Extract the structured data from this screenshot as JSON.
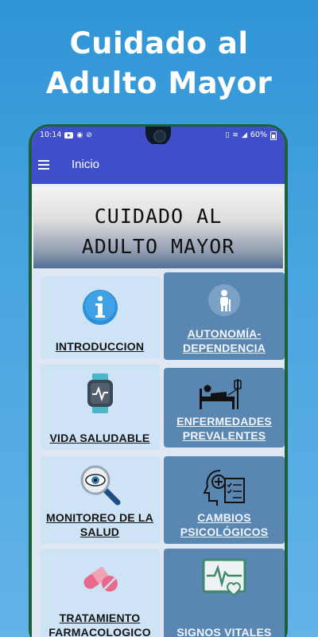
{
  "promo": {
    "line1": "Cuidado al",
    "line2": "Adulto Mayor"
  },
  "status_bar": {
    "time": "10:14",
    "battery": "60%"
  },
  "app_bar": {
    "title": "Inicio"
  },
  "banner": {
    "line1": "CUIDADO AL",
    "line2": "ADULTO MAYOR"
  },
  "cards": [
    {
      "label": "INTRODUCCION",
      "icon": "info-icon"
    },
    {
      "label": "AUTONOMÍA-DEPENDENCIA",
      "icon": "elderly-person-icon"
    },
    {
      "label": "VIDA SALUDABLE",
      "icon": "smartwatch-icon"
    },
    {
      "label": "ENFERMEDADES PREVALENTES",
      "icon": "hospital-bed-icon"
    },
    {
      "label": "MONITOREO DE LA SALUD",
      "icon": "magnifier-eye-icon"
    },
    {
      "label": "CAMBIOS PSICOLÓGICOS",
      "icon": "head-checklist-icon"
    },
    {
      "label": "TRATAMIENTO FARMACOLOGICO",
      "icon": "pill-icon"
    },
    {
      "label": "SIGNOS VITALES",
      "icon": "heartbeat-monitor-icon"
    }
  ],
  "colors": {
    "accent": "#3f4fc9",
    "card_light": "#cfe3f7",
    "card_dark": "#5a86b2",
    "background": "#3a9ddb"
  }
}
